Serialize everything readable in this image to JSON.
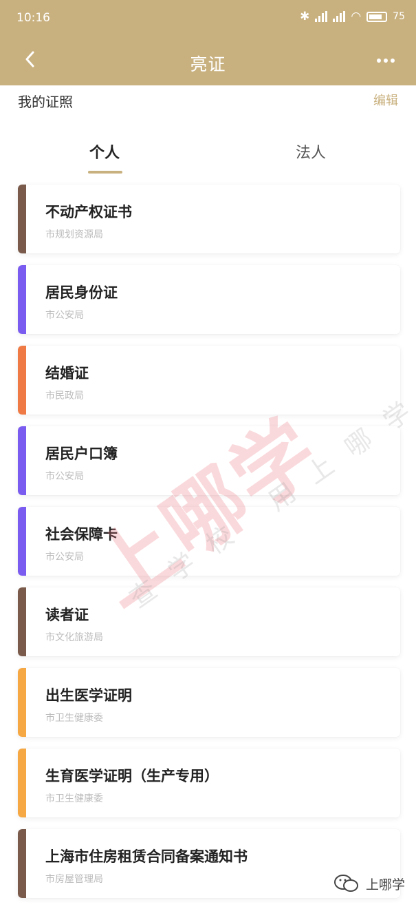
{
  "status": {
    "time": "10:16",
    "battery": "75"
  },
  "nav": {
    "title": "亮证"
  },
  "section": {
    "title": "我的证照",
    "edit": "编辑"
  },
  "tabs": [
    {
      "label": "个人",
      "active": true
    },
    {
      "label": "法人",
      "active": false
    }
  ],
  "cards": [
    {
      "name": "不动产权证书",
      "dept": "市规划资源局",
      "color": "#7a5a4a"
    },
    {
      "name": "居民身份证",
      "dept": "市公安局",
      "color": "#7b5cf0"
    },
    {
      "name": "结婚证",
      "dept": "市民政局",
      "color": "#f07a45"
    },
    {
      "name": "居民户口簿",
      "dept": "市公安局",
      "color": "#7b5cf0"
    },
    {
      "name": "社会保障卡",
      "dept": "市公安局",
      "color": "#7b5cf0"
    },
    {
      "name": "读者证",
      "dept": "市文化旅游局",
      "color": "#7a5a4a"
    },
    {
      "name": "出生医学证明",
      "dept": "市卫生健康委",
      "color": "#f5a843"
    },
    {
      "name": "生育医学证明（生产专用）",
      "dept": "市卫生健康委",
      "color": "#f5a843"
    },
    {
      "name": "上海市住房租赁合同备案通知书",
      "dept": "市房屋管理局",
      "color": "#7a5a4a"
    }
  ],
  "watermark": {
    "big": "上哪学",
    "small": "查学校 用上哪学",
    "footer": "上哪学"
  },
  "colors": {
    "accent": "#c9b17f"
  },
  "icons": {
    "back": "chevron-left-icon",
    "more": "more-dots-icon",
    "wechat": "wechat-icon"
  }
}
